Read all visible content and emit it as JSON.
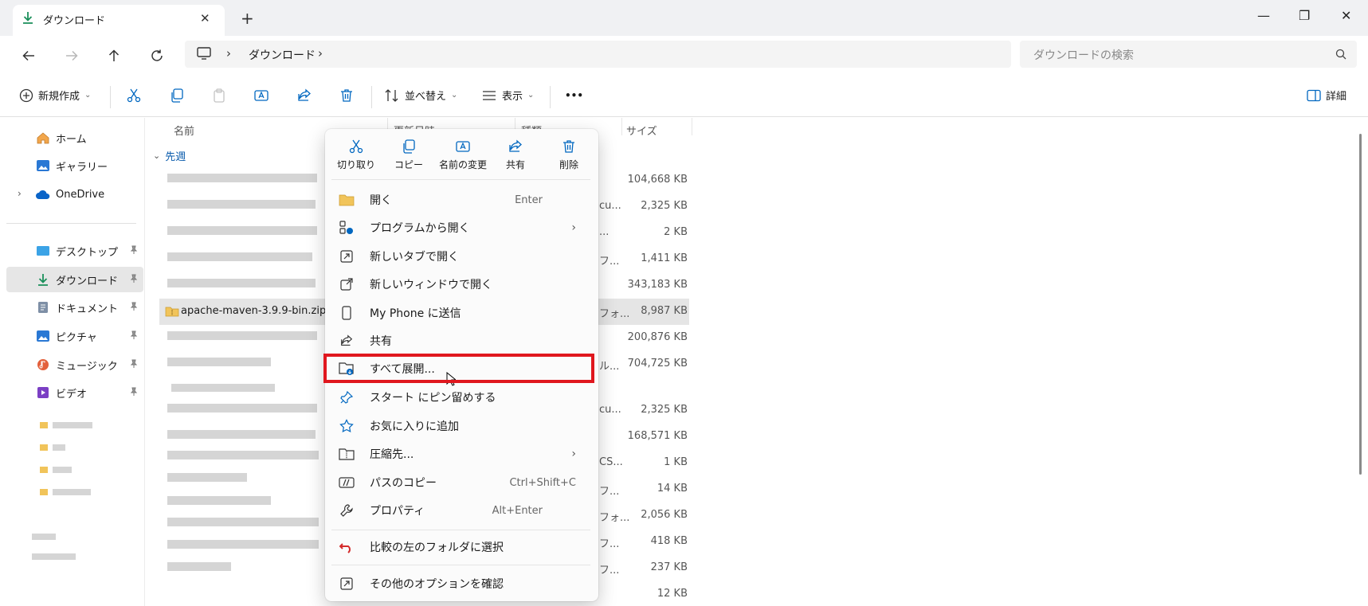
{
  "window": {
    "tab_title": "ダウンロード",
    "close_tab": "✕",
    "new_tab": "+",
    "minimize": "—",
    "restore": "❐",
    "close": "✕"
  },
  "address": {
    "segment": "ダウンロード",
    "sep": "›",
    "search_placeholder": "ダウンロードの検索"
  },
  "commands": {
    "new": "新規作成",
    "sort": "並べ替え",
    "view": "表示",
    "more": "•••",
    "details": "詳細"
  },
  "sidebar": {
    "items": [
      {
        "label": "ホーム",
        "icon": "home-icon"
      },
      {
        "label": "ギャラリー",
        "icon": "gallery-icon"
      },
      {
        "label": "OneDrive",
        "icon": "cloud-icon"
      },
      {
        "label": "デスクトップ",
        "icon": "desktop-icon"
      },
      {
        "label": "ダウンロード",
        "icon": "download-icon"
      },
      {
        "label": "ドキュメント",
        "icon": "document-icon"
      },
      {
        "label": "ピクチャ",
        "icon": "picture-icon"
      },
      {
        "label": "ミュージック",
        "icon": "music-icon"
      },
      {
        "label": "ビデオ",
        "icon": "video-icon"
      }
    ]
  },
  "list": {
    "headers": {
      "name": "名前",
      "date": "更新日時",
      "type": "種類",
      "size": "サイズ"
    },
    "group": "先週",
    "selected_file": "apache-maven-3.9.9-bin.zip",
    "sizes": [
      "104,668 KB",
      "2,325 KB",
      "2 KB",
      "1,411 KB",
      "343,183 KB",
      "8,987 KB",
      "200,876 KB",
      "704,725 KB",
      "2,325 KB",
      "168,571 KB",
      "1 KB",
      "14 KB",
      "2,056 KB",
      "418 KB",
      "237 KB",
      "12 KB"
    ],
    "type_fragments": [
      "...",
      "cu...",
      "...",
      "フ...",
      "",
      "フォ...",
      "",
      "ル...",
      "cu...",
      "",
      "CS...",
      "フ...",
      "フォ...",
      "フ...",
      "フ...",
      ""
    ]
  },
  "context_menu": {
    "quick": [
      "切り取り",
      "コピー",
      "名前の変更",
      "共有",
      "削除"
    ],
    "items": [
      {
        "label": "開く",
        "shortcut": "Enter"
      },
      {
        "label": "プログラムから開く",
        "submenu": "›"
      },
      {
        "label": "新しいタブで開く"
      },
      {
        "label": "新しいウィンドウで開く"
      },
      {
        "label": "My Phone に送信"
      },
      {
        "label": "共有"
      },
      {
        "label": "すべて展開..."
      },
      {
        "label": "スタート にピン留めする"
      },
      {
        "label": "お気に入りに追加"
      },
      {
        "label": "圧縮先...",
        "submenu": "›"
      },
      {
        "label": "パスのコピー",
        "shortcut": "Ctrl+Shift+C"
      },
      {
        "label": "プロパティ",
        "shortcut": "Alt+Enter"
      },
      {
        "label": "比較の左のフォルダに選択"
      },
      {
        "label": "その他のオプションを確認"
      }
    ]
  },
  "colors": {
    "highlight": "#e0171e",
    "accent": "#0067c0"
  }
}
